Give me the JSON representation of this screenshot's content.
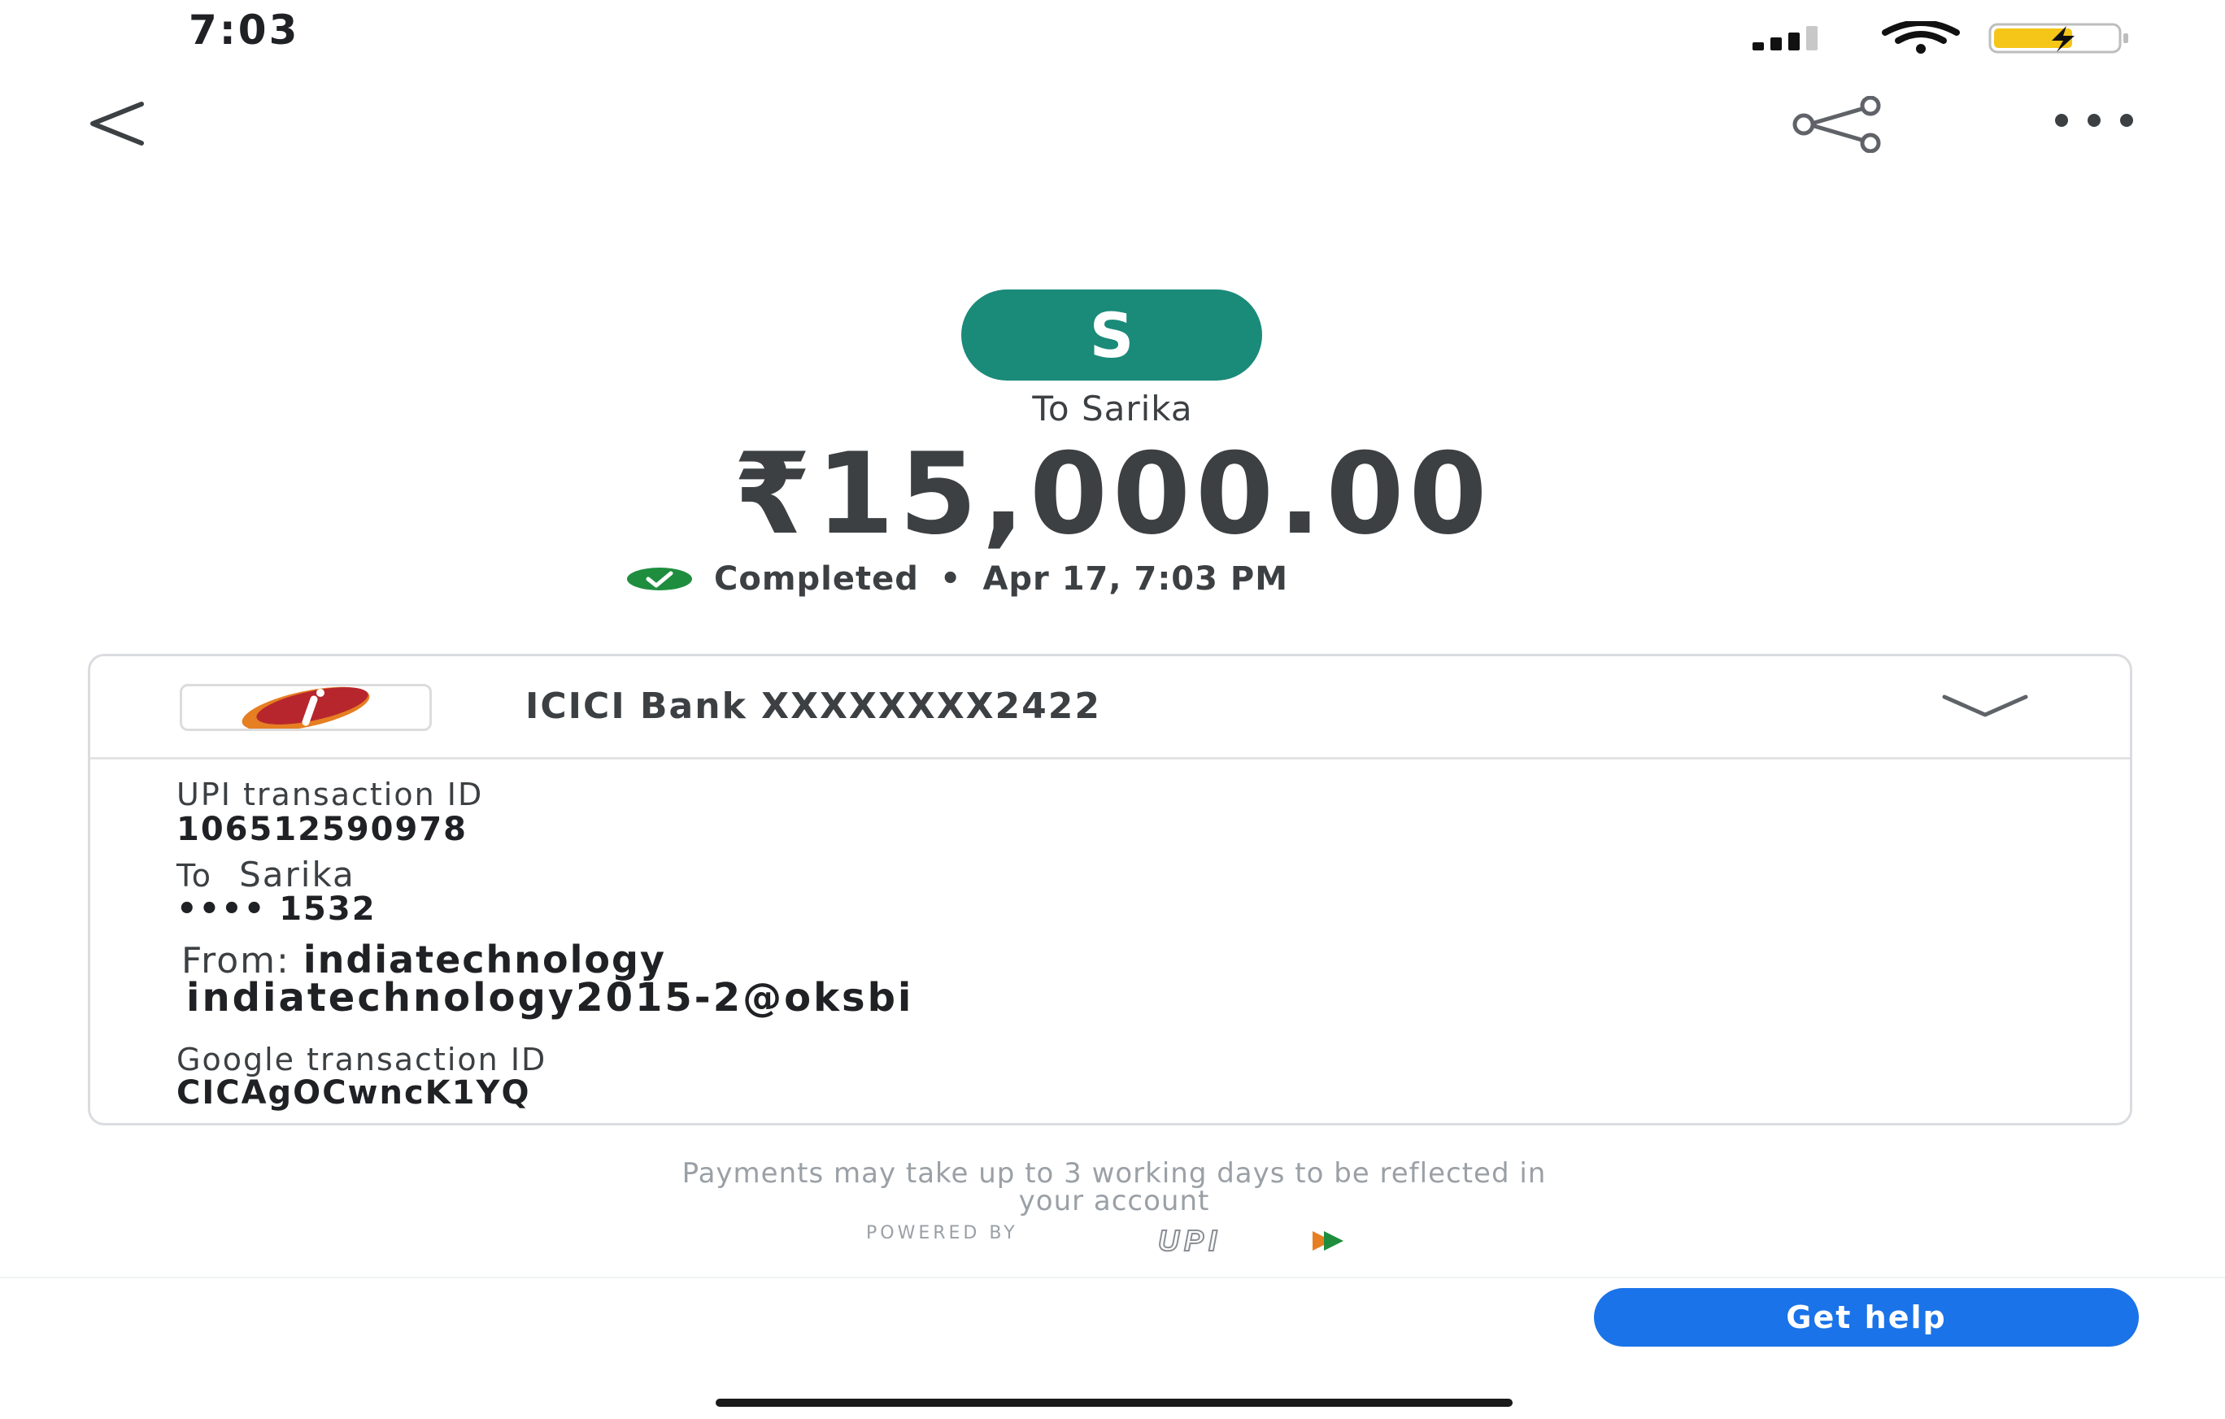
{
  "status_bar": {
    "time": "7:03"
  },
  "payment": {
    "avatar_letter": "S",
    "recipient": "To Sarika",
    "amount": "₹15,000.00",
    "status": "Completed",
    "separator": "•",
    "datetime": "Apr 17, 7:03 PM"
  },
  "account": {
    "bank_name": "ICICI Bank XXXXXXXX2422"
  },
  "details": {
    "upi_label": "UPI transaction ID",
    "upi_id": "106512590978",
    "to_label": "To",
    "to_name": "Sarika",
    "to_masked": "•••• 1532",
    "from_label": "From:",
    "from_name": "indiatechnology",
    "from_vpa": "indiatechnology2015-2@oksbi",
    "gtid_label": "Google transaction ID",
    "gtid_value": "CICAgOCwncK1YQ"
  },
  "notice": {
    "line1": "Payments may take up to 3 working days to be reflected in",
    "line2": "your account"
  },
  "footer": {
    "powered_by": "POWERED BY",
    "upi_logo_text": "UPI"
  },
  "actions": {
    "get_help": "Get help"
  },
  "colors": {
    "avatar_bg": "#1a8a79",
    "success": "#1e8e3e",
    "primary": "#1a73e8",
    "upi_orange": "#e67e22"
  },
  "icons": [
    "signal-icon",
    "wifi-icon",
    "battery-charging-icon",
    "back-arrow-icon",
    "share-icon",
    "more-horiz-icon",
    "check-circle-icon",
    "icici-logo",
    "chevron-down-icon",
    "upi-logo"
  ]
}
